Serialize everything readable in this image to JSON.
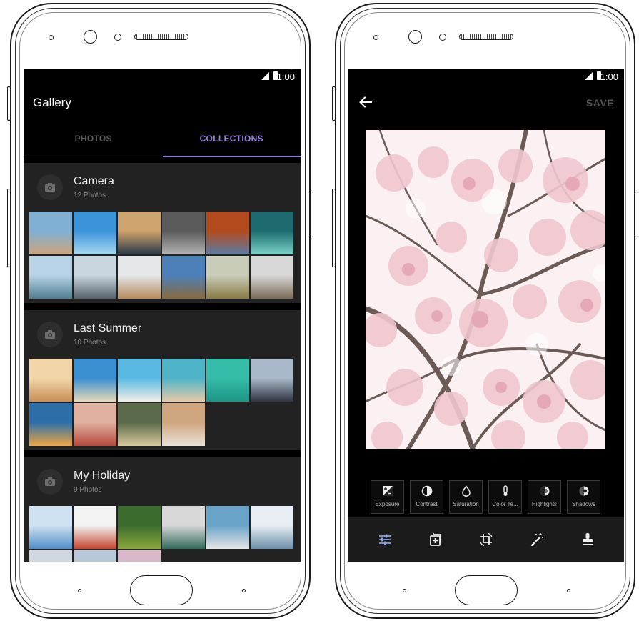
{
  "status": {
    "time": "1:00"
  },
  "gallery": {
    "title": "Gallery",
    "tabs": [
      {
        "label": "PHOTOS",
        "active": false
      },
      {
        "label": "COLLECTIONS",
        "active": true
      }
    ],
    "accent_color": "#9b7fe0",
    "collections": [
      {
        "name": "Camera",
        "count": "12 Photos",
        "thumbs": [
          "#7fb0d3,#d0a47a",
          "#3b93d8,#a8d8f0",
          "#cfa36d,#2a3a4a",
          "#5a5a5a,#b3b3b3",
          "#b24a1e,#5a7da8",
          "#1d6b6e,#7ad3c8",
          "#b8d3e8,#4f7e8f",
          "#c9d6e0,#55606a",
          "#e4e6e8,#b88a5a",
          "#4d7fb8,#8a6a3a",
          "#c9ccb8,#8a7a44",
          "#d8d8d8,#7a6a55"
        ]
      },
      {
        "name": "Last Summer",
        "count": "10 Photos",
        "thumbs": [
          "#f2d6a8,#c98f55",
          "#3a8fd1,#e8d8b8",
          "#5ab9e3,#f3efe6",
          "#4fb4c8,#e6c9a8",
          "#35bda9,#1e9486",
          "#a9b9c9,#2e3440",
          "#2e6ea8,#f0a640",
          "#e0b0a0,#b8483e",
          "#5a6a4a,#d8c89a",
          "#cfa680,#e9e1d8"
        ]
      },
      {
        "name": "My Holiday",
        "count": "9 Photos",
        "thumbs": [
          "#cfe2f2,#4f8fc8",
          "#f3f3f3,#c8452e",
          "#3c6b2e,#8aa83a",
          "#d8d8d8,#2f6b5a",
          "#6aa3c8,#e6e6e6",
          "#e8eef3,#6a8faa",
          "#cfd8e0,#f0f0f0",
          "#b8c8d8,#f2f2f2",
          "#d8b8c8,#f0e0e8"
        ]
      }
    ]
  },
  "editor": {
    "save_label": "SAVE",
    "tools": [
      {
        "label": "Exposure",
        "icon": "exposure-icon"
      },
      {
        "label": "Contrast",
        "icon": "contrast-icon"
      },
      {
        "label": "Saturation",
        "icon": "saturation-icon"
      },
      {
        "label": "Color Te...",
        "icon": "color-temperature-icon"
      },
      {
        "label": "Highlights",
        "icon": "highlights-icon"
      },
      {
        "label": "Shadows",
        "icon": "shadows-icon"
      }
    ],
    "bottom_tools": [
      "adjust-icon",
      "filter-icon",
      "crop-rotate-icon",
      "magic-wand-icon",
      "stamp-icon"
    ],
    "active_bottom_color": "#8fa3e8"
  }
}
